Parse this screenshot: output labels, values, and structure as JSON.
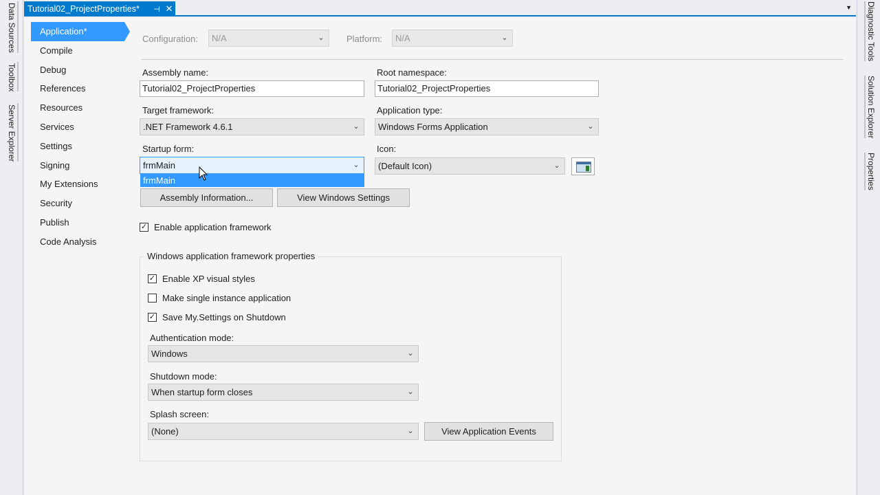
{
  "left_tabs": [
    "Data Sources",
    "Toolbox",
    "Server Explorer"
  ],
  "right_tabs": [
    "Diagnostic Tools",
    "Solution Explorer",
    "Properties"
  ],
  "doc_tab": {
    "title": "Tutorial02_ProjectProperties*",
    "pin": "⊣",
    "close": "✕"
  },
  "nav": [
    "Application*",
    "Compile",
    "Debug",
    "References",
    "Resources",
    "Services",
    "Settings",
    "Signing",
    "My Extensions",
    "Security",
    "Publish",
    "Code Analysis"
  ],
  "config": {
    "configuration_label": "Configuration:",
    "configuration_value": "N/A",
    "platform_label": "Platform:",
    "platform_value": "N/A"
  },
  "form": {
    "assembly_name_label": "Assembly name:",
    "assembly_name": "Tutorial02_ProjectProperties",
    "root_namespace_label": "Root namespace:",
    "root_namespace": "Tutorial02_ProjectProperties",
    "target_framework_label": "Target framework:",
    "target_framework": ".NET Framework 4.6.1",
    "application_type_label": "Application type:",
    "application_type": "Windows Forms Application",
    "startup_form_label": "Startup form:",
    "startup_form": "frmMain",
    "startup_form_option": "frmMain",
    "icon_label": "Icon:",
    "icon_value": "(Default Icon)",
    "assembly_info_button": "Assembly Information...",
    "view_windows_settings_button": "View Windows Settings",
    "enable_app_framework": "Enable application framework"
  },
  "group": {
    "title": "Windows application framework properties",
    "xp_styles": "Enable XP visual styles",
    "single_instance": "Make single instance application",
    "save_settings": "Save My.Settings on Shutdown",
    "auth_mode_label": "Authentication mode:",
    "auth_mode": "Windows",
    "shutdown_mode_label": "Shutdown mode:",
    "shutdown_mode": "When startup form closes",
    "splash_label": "Splash screen:",
    "splash": "(None)",
    "view_events_button": "View Application Events"
  },
  "checks": {
    "enable_app_framework": true,
    "xp_styles": true,
    "single_instance": false,
    "save_settings": true
  }
}
